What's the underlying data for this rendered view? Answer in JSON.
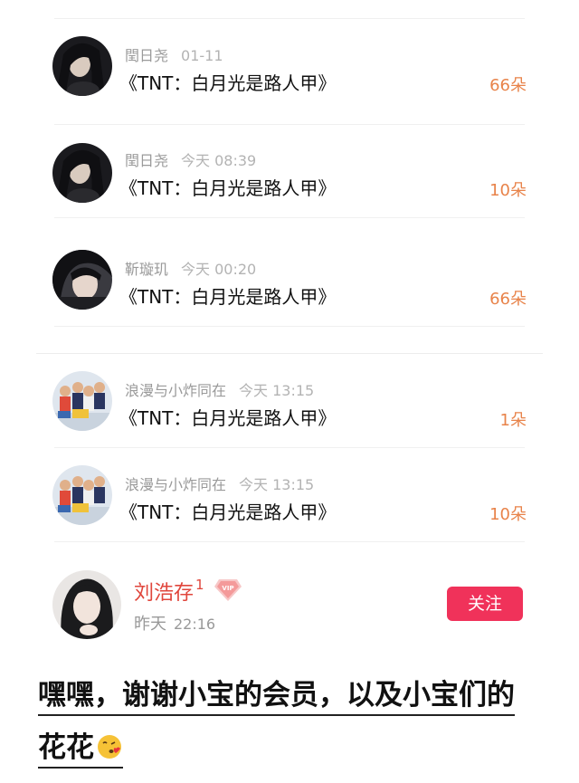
{
  "gift_list": [
    {
      "user": "閏日尧",
      "time": "01-11",
      "item": "《TNT：白月光是路人甲》",
      "amount": "66朵",
      "avatar": "woman-dark-hair-portrait-icon"
    },
    {
      "user": "閏日尧",
      "time": "今天 08:39",
      "item": "《TNT：白月光是路人甲》",
      "amount": "10朵",
      "avatar": "woman-dark-hair-portrait-icon"
    },
    {
      "user": "靳璇玑",
      "time": "今天 00:20",
      "item": "《TNT：白月光是路人甲》",
      "amount": "66朵",
      "avatar": "girl-profile-portrait-icon"
    },
    {
      "user": "浪漫与小炸同在",
      "time": "今天 13:15",
      "item": "《TNT：白月光是路人甲》",
      "amount": "1朵",
      "avatar": "group-photo-icon"
    },
    {
      "user": "浪漫与小炸同在",
      "time": "今天 13:15",
      "item": "《TNT：白月光是路人甲》",
      "amount": "10朵",
      "avatar": "group-photo-icon"
    }
  ],
  "post": {
    "author": "刘浩存",
    "level": "1",
    "badge": "VIP",
    "date": "昨天",
    "time": "22:16",
    "follow_label": "关注"
  },
  "caption": {
    "line1": "嘿嘿，谢谢小宝的会员，以及小宝们的",
    "line2": "花花",
    "emoji": "kissing-face-emoji-icon"
  },
  "colors": {
    "amount": "#e8834a",
    "author": "#e0463c",
    "follow_button": "#f0325a"
  }
}
